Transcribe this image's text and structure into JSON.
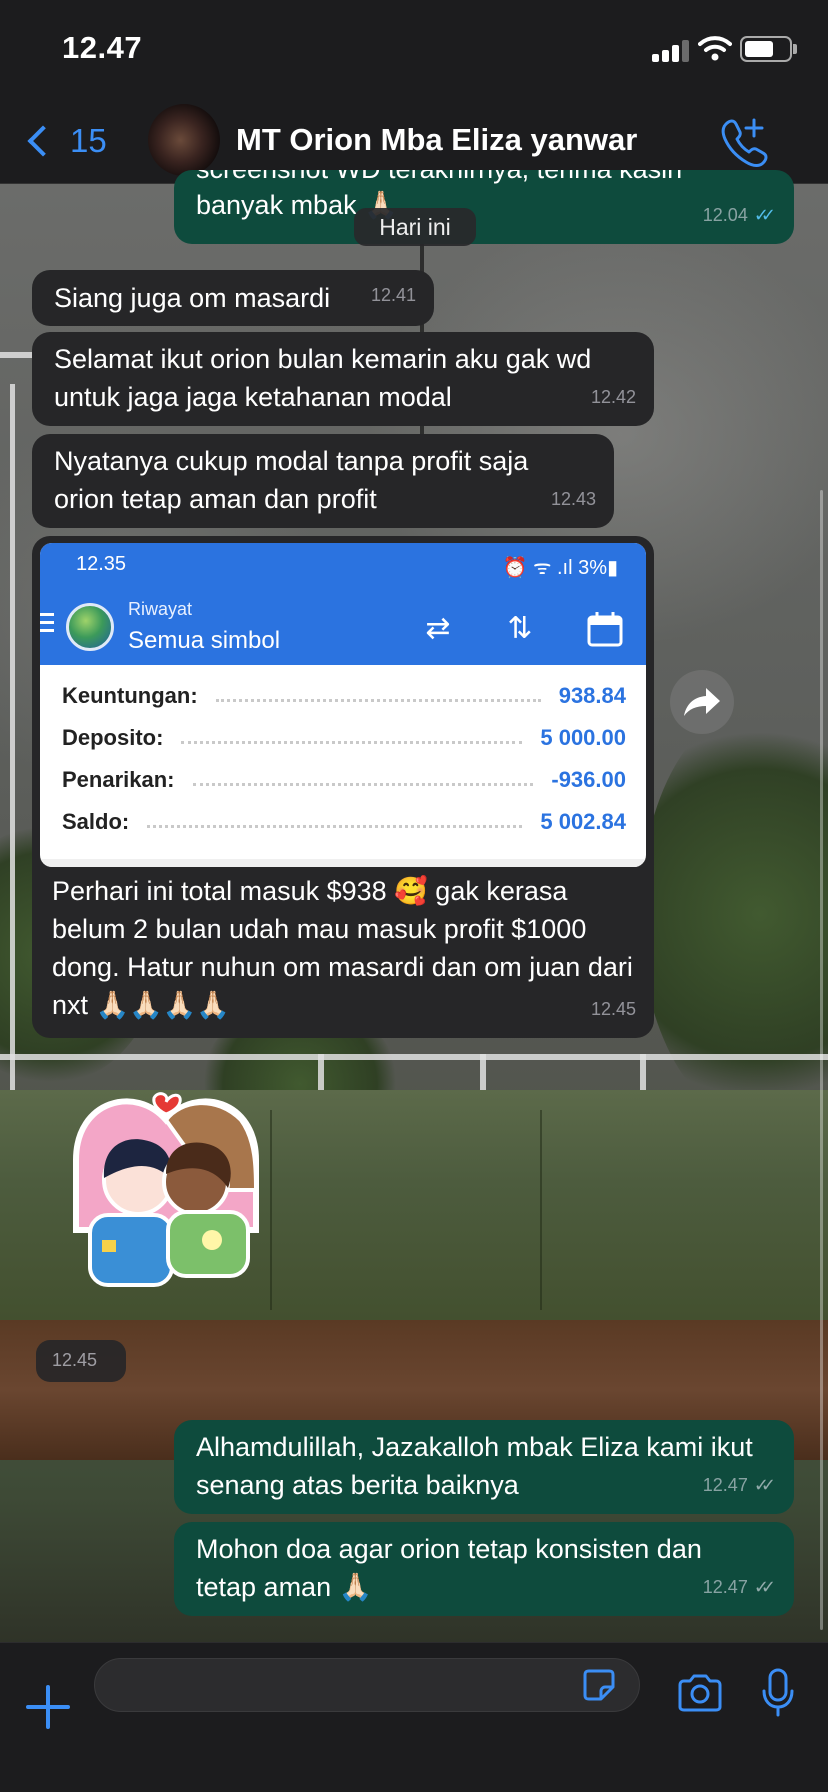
{
  "status_bar": {
    "time": "12.47"
  },
  "header": {
    "back_count": "15",
    "title": "MT Orion Mba Eliza yanwar"
  },
  "date_pill": "Hari ini",
  "messages": [
    {
      "dir": "out",
      "text_partial": "screenshot WD terakhirnya, terima kasih",
      "text": "banyak mbak 🙏🏻",
      "time": "12.04",
      "ticks": "read"
    },
    {
      "dir": "in",
      "text": "Siang juga om masardi",
      "time": "12.41"
    },
    {
      "dir": "in",
      "text": "Selamat ikut orion bulan kemarin aku gak wd untuk jaga jaga ketahanan modal",
      "time": "12.42"
    },
    {
      "dir": "in",
      "text": "Nyatanya cukup modal tanpa profit saja orion tetap aman dan profit",
      "time": "12.43"
    },
    {
      "dir": "in",
      "text": "Perhari ini total masuk $938 🥰 gak kerasa belum 2 bulan udah mau masuk profit $1000 dong. Hatur nuhun om masardi dan om juan dari nxt 🙏🏻🙏🏻🙏🏻🙏🏻",
      "time": "12.45"
    },
    {
      "dir": "out",
      "text": "Alhamdulillah, Jazakalloh mbak Eliza kami ikut senang atas berita baiknya",
      "time": "12.47",
      "ticks": "sent"
    },
    {
      "dir": "out",
      "text": "Mohon doa agar orion tetap konsisten dan tetap aman 🙏🏻",
      "time": "12.47",
      "ticks": "sent"
    }
  ],
  "sticker_time": "12.45",
  "embedded_screenshot": {
    "time": "12.35",
    "status": "⏰ ᯤ .ıl 3%▮",
    "subtitle": "Riwayat",
    "title": "Semua simbol",
    "rows": [
      {
        "label": "Keuntungan:",
        "value": "938.84"
      },
      {
        "label": "Deposito:",
        "value": "5 000.00"
      },
      {
        "label": "Penarikan:",
        "value": "-936.00"
      },
      {
        "label": "Saldo:",
        "value": "5 002.84"
      }
    ]
  },
  "colors": {
    "accent": "#3b8ef5",
    "incoming_bubble": "#262628",
    "outgoing_bubble": "#0e4b3d",
    "mt_blue": "#2b73e0",
    "read_ticks": "#53bdeb"
  },
  "icons": [
    "chevron-left-icon",
    "add-call-icon",
    "forward-icon",
    "plus-icon",
    "sticker-icon",
    "camera-icon",
    "microphone-icon"
  ]
}
